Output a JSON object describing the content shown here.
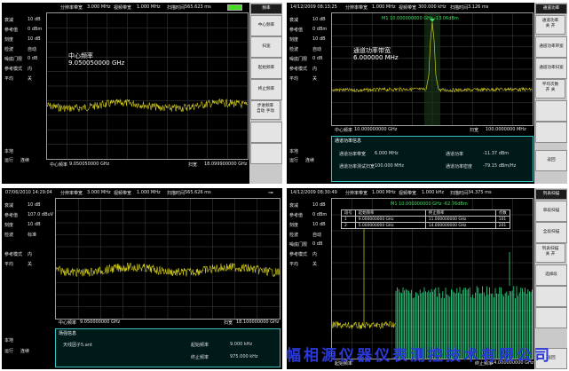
{
  "colors": {
    "trace": "#d4cf1e",
    "trace_green": "#2ee08a",
    "marker": "#40e060",
    "accent": "#37c3c3"
  },
  "icons": {
    "battery": "battery-icon",
    "plug": "plug-icon"
  },
  "panes": [
    {
      "top": {
        "date": "",
        "res_label": "分辨率带宽",
        "res_val": "3.000 MHz",
        "vid_label": "视频带宽",
        "vid_val": "1.000 MHz",
        "sweep_label": "扫描时间",
        "sweep_val": "565.623 ms"
      },
      "left": [
        {
          "k": "衰减",
          "v": "10 dB"
        },
        {
          "k": "参考值",
          "v": "0 dBm"
        },
        {
          "k": "刻度",
          "v": "10 dB"
        },
        {
          "k": "检波",
          "v": "自动"
        },
        {
          "k": "噪底门限",
          "v": "0 dB"
        },
        {
          "k": "参考模式",
          "v": "内"
        },
        {
          "k": "平均",
          "v": "关"
        }
      ],
      "left_bottom": [
        {
          "k": "本地",
          "v": ""
        },
        {
          "k": "运行",
          "v": "连续"
        }
      ],
      "overlay": {
        "line1": "中心频率",
        "line2": "9.050050000 GHz"
      },
      "bottom": {
        "c_label": "中心频率",
        "c_val": "9.050050000 GHz",
        "s_label": "扫宽",
        "s_val": "18.099900000 GHz"
      },
      "menu": [
        {
          "label": "频率",
          "sub": "",
          "sel": true
        },
        {
          "label": "中心频率",
          "sub": "",
          "sel": false
        },
        {
          "label": "扫宽",
          "sub": "",
          "sel": false
        },
        {
          "label": "起始频率",
          "sub": "",
          "sel": false
        },
        {
          "label": "终止频率",
          "sub": "",
          "sel": false
        },
        {
          "label": "步进频率",
          "sub": "自动    手动",
          "sel": false
        },
        {
          "label": "",
          "sub": "",
          "sel": false
        },
        {
          "label": "",
          "sub": "",
          "sel": false
        }
      ]
    },
    {
      "top": {
        "date": "14/12/2009  08:13:25",
        "res_label": "分辨率带宽",
        "res_val": "1.000 MHz",
        "vid_label": "视频带宽",
        "vid_val": "300.000 kHz",
        "sweep_label": "扫描时间",
        "sweep_val": "3.126 ms"
      },
      "left": [
        {
          "k": "衰减",
          "v": "10 dB"
        },
        {
          "k": "参考值",
          "v": "0 dBm"
        },
        {
          "k": "刻度",
          "v": "10 dB"
        },
        {
          "k": "检波",
          "v": "自动"
        },
        {
          "k": "噪底门限",
          "v": "0 dB"
        },
        {
          "k": "参考模式",
          "v": "内"
        },
        {
          "k": "平均",
          "v": "关"
        }
      ],
      "left_bottom": [
        {
          "k": "本地",
          "v": ""
        },
        {
          "k": "运行",
          "v": "连续"
        }
      ],
      "marker": "M1  10.000000000 GHz       -13.06dBm",
      "overlay": {
        "line1": "通道功率带宽",
        "line2": "6.000000 MHz"
      },
      "bottom": {
        "c_label": "中心频率",
        "c_val": "10.000000000 GHz",
        "s_label": "扫宽",
        "s_val": "100.0000000 MHz"
      },
      "panel": {
        "title": "通道功率信息",
        "rows": [
          {
            "a": "通道功率带宽",
            "b": "6.000 MHz",
            "c": "通道功率",
            "d": "-11.37 dBm"
          },
          {
            "a": "通道功率测试扫宽",
            "b": "100.000 MHz",
            "c": "通道功率密度",
            "d": "-79.15 dBm/Hz"
          }
        ]
      },
      "menu": [
        {
          "label": "通道功率",
          "sub": "",
          "sel": true
        },
        {
          "label": "通道功率",
          "sub": "关    开",
          "sel": false
        },
        {
          "label": "通道功率带宽",
          "sub": "",
          "sel": false
        },
        {
          "label": "通道功率扫宽",
          "sub": "",
          "sel": false
        },
        {
          "label": "平均次数",
          "sub": "开    关",
          "sel": false
        },
        {
          "label": "",
          "sub": "",
          "sel": false
        },
        {
          "label": "",
          "sub": "",
          "sel": false
        },
        {
          "label": "返回",
          "sub": "",
          "sel": false
        }
      ]
    },
    {
      "top": {
        "date": "07/06/2010  14:29:04",
        "res_label": "分辨率带宽",
        "res_val": "3.000 MHz",
        "vid_label": "视频带宽",
        "vid_val": "1.000 MHz",
        "sweep_label": "扫描时间",
        "sweep_val": "565.626 ms"
      },
      "left": [
        {
          "k": "衰减",
          "v": "10 dB"
        },
        {
          "k": "参考值",
          "v": "107.0 dBuV"
        },
        {
          "k": "刻度",
          "v": "10 dB"
        },
        {
          "k": "检波",
          "v": "标准"
        },
        {
          "k": "",
          "v": ""
        },
        {
          "k": "参考模式",
          "v": "内"
        },
        {
          "k": "平均",
          "v": "关"
        }
      ],
      "left_bottom": [
        {
          "k": "本地",
          "v": ""
        },
        {
          "k": "运行",
          "v": "连续"
        }
      ],
      "bottom": {
        "c_label": "中心频率",
        "c_val": "9.050000000 GHz",
        "s_label": "扫宽",
        "s_val": "18.100000000 GHz"
      },
      "panel": {
        "title": "场强信息",
        "rows": [
          {
            "a": "天线因子5.ant",
            "b": "",
            "c": "起始频率",
            "d": "9.000 kHz"
          },
          {
            "a": "",
            "b": "",
            "c": "终止频率",
            "d": "975.000 kHz"
          }
        ]
      },
      "menu": []
    },
    {
      "top": {
        "date": "14/12/2009  08:30:49",
        "res_label": "分辨率带宽",
        "res_val": "1.000 MHz",
        "vid_label": "视频带宽",
        "vid_val": "1.000 kHz",
        "sweep_label": "扫描时间",
        "sweep_val": "34.375 ms"
      },
      "left": [
        {
          "k": "衰减",
          "v": "10 dB"
        },
        {
          "k": "参考值",
          "v": "0 dBm"
        },
        {
          "k": "刻度",
          "v": "10 dB"
        },
        {
          "k": "检波",
          "v": "自动"
        },
        {
          "k": "噪底门限",
          "v": "0 dB"
        },
        {
          "k": "参考模式",
          "v": "内"
        },
        {
          "k": "平均",
          "v": "关"
        }
      ],
      "left_bottom": [],
      "marker": "M1  10.000000000 GHz       -62.76dBm",
      "table": {
        "header": [
          "段号",
          "起始频率",
          "终止频率",
          "点数"
        ],
        "rows": [
          [
            "1",
            "9.000000000 GHz",
            "11.000000000 GHz",
            "101"
          ],
          [
            "2",
            "5.000000000 GHz",
            "14.000000000 GHz",
            "201"
          ]
        ]
      },
      "bottom": {
        "c_label": "起始频率",
        "c_val": "",
        "s_label": "终止频率",
        "s_val": "14.000000000 GHz"
      },
      "menu": [
        {
          "label": "列表扫描",
          "sub": "",
          "sel": true
        },
        {
          "label": "单段扫描",
          "sub": "",
          "sel": false
        },
        {
          "label": "全段扫描",
          "sub": "",
          "sel": false
        },
        {
          "label": "列表扫描",
          "sub": "关    开",
          "sel": false
        },
        {
          "label": "选择段",
          "sub": "",
          "sel": false
        },
        {
          "label": "",
          "sub": "",
          "sel": false
        },
        {
          "label": "",
          "sub": "",
          "sel": false
        },
        {
          "label": "返回",
          "sub": "",
          "sel": false
        }
      ]
    }
  ],
  "watermark": "幅相源仪器仪表测控技术有限公司"
}
